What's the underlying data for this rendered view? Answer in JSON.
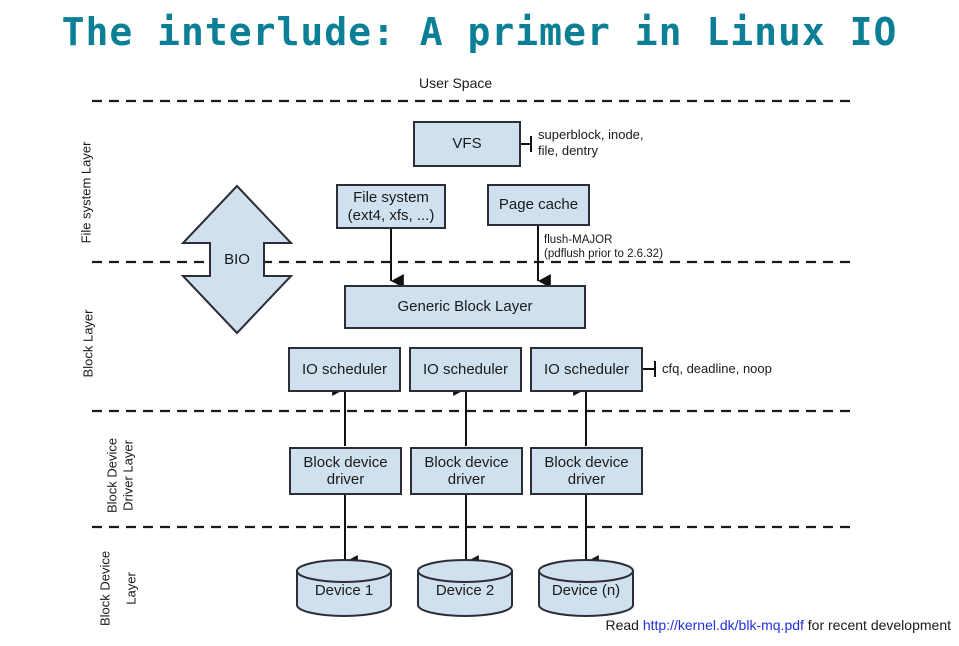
{
  "slide": {
    "title": "The interlude: A primer in Linux IO",
    "title_color": "#0b7f95"
  },
  "diagram": {
    "user_space_label": "User Space",
    "bio_label": "BIO",
    "box_fill": "#cfe0ef",
    "box_stroke": "#2d2d38",
    "layer_labels": [
      {
        "id": "file-system-layer",
        "text": "File system Layer"
      },
      {
        "id": "block-layer",
        "text": "Block Layer"
      },
      {
        "id": "block-device-driver-layer-line1",
        "text": "Block Device"
      },
      {
        "id": "block-device-driver-layer-line2",
        "text": "Driver Layer"
      },
      {
        "id": "block-device-layer-line1",
        "text": "Block Device"
      },
      {
        "id": "block-device-layer-line2",
        "text": "Layer"
      }
    ],
    "boxes": {
      "vfs": "VFS",
      "file_system_line1": "File system",
      "file_system_line2": "(ext4, xfs, ...)",
      "page_cache": "Page cache",
      "generic_block_layer": "Generic Block Layer",
      "io_scheduler_1": "IO scheduler",
      "io_scheduler_2": "IO scheduler",
      "io_scheduler_3": "IO scheduler",
      "driver_1_line1": "Block device",
      "driver_1_line2": "driver",
      "driver_2_line1": "Block device",
      "driver_2_line2": "driver",
      "driver_3_line1": "Block device",
      "driver_3_line2": "driver"
    },
    "devices": [
      {
        "id": "device-1",
        "label": "Device 1"
      },
      {
        "id": "device-2",
        "label": "Device 2"
      },
      {
        "id": "device-n",
        "label": "Device (n)"
      }
    ],
    "annotations": {
      "vfs_note_line1": "superblock, inode,",
      "vfs_note_line2": "file, dentry",
      "flush_note_line1": "flush-MAJOR",
      "flush_note_line2": "(pdflush prior to 2.6.32)",
      "scheduler_note": "cfq, deadline, noop"
    }
  },
  "footer": {
    "read_prefix": "Read ",
    "link_text": "http://kernel.dk/blk-mq.pdf",
    "read_suffix": " for recent development",
    "link_color": "#2030dd"
  }
}
